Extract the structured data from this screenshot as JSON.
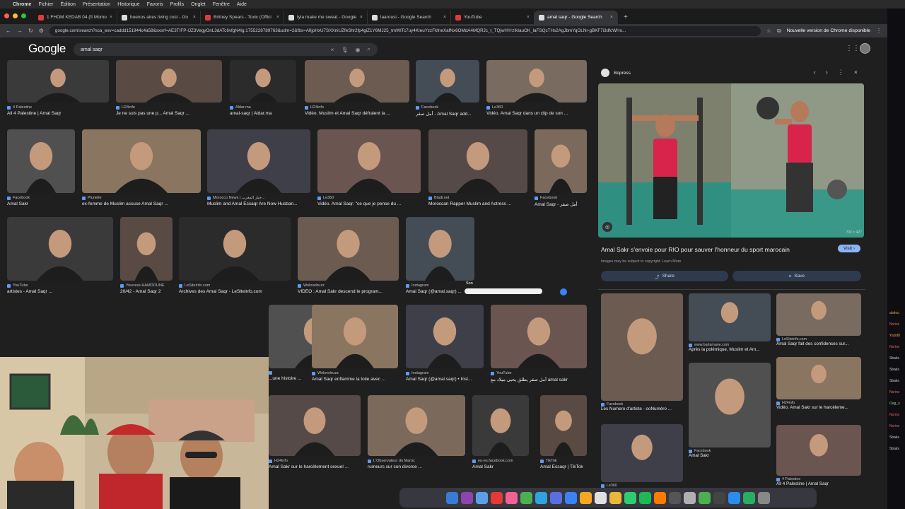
{
  "menubar": {
    "app": "Chrome",
    "items": [
      "Fichier",
      "Édition",
      "Présentation",
      "Historique",
      "Favoris",
      "Profils",
      "Onglet",
      "Fenêtre",
      "Aide"
    ]
  },
  "tabs": [
    {
      "title": "1 FHOM KEDAB 04 (ft Momo",
      "fav": "#e03c3c",
      "active": false
    },
    {
      "title": "buenos aires living cost - Go",
      "fav": "#dddddd",
      "active": false
    },
    {
      "title": "Britney Spears - Toxic (Offici",
      "fav": "#e03c3c",
      "active": false
    },
    {
      "title": "tyla make me sweat - Google",
      "fav": "#dddddd",
      "active": false
    },
    {
      "title": "laarousi - Google Search",
      "fav": "#dddddd",
      "active": false
    },
    {
      "title": "YouTube",
      "fav": "#e03c3c",
      "active": false
    },
    {
      "title": "amal saqr - Google Search",
      "fav": "#dddddd",
      "active": true
    }
  ],
  "toolbar": {
    "url": "google.com/search?sca_esv=caddd151944c4a58&sxsrf=AE3TIFP-lJZ3VegyOnL3dATc6vfgN4Ig:1755228789763&udm=2&fbs=AIIjpHxU7SXXniUZfeShr2fp4giZ1Y6MJ25_tmWITc7uy4KIeuYzzFkfneXafNx6OMdA4MQRJc_t_TQjwHYrzIkIauOK_laFSQcTHs2AgJbmYqOLNr-gBKF7i3dfcWHo...",
    "update_label": "Nouvelle version de Chrome disponible"
  },
  "google": {
    "logo": "Google",
    "query": "amal saqr"
  },
  "results": [
    {
      "src": "4 Palestine",
      "title": "All 4 Palestine | Amal Saqr"
    },
    {
      "src": "H24info",
      "title": "Je ne suis pas une p... Amal Saqr ..."
    },
    {
      "src": "Aldar.ma",
      "title": "amal-saqr | Aldar.ma"
    },
    {
      "src": "H24info",
      "title": "Vidéo. Muslim et Amal Saqr défraient la ..."
    },
    {
      "src": "Facebook",
      "title": "أمل صقر - Amal Saqr add..."
    },
    {
      "src": "Le360",
      "title": "Vidéo. Amal Saqr dans un clip de son ..."
    },
    {
      "src": "Facebook",
      "title": "Amal Sakr"
    },
    {
      "src": "Plurielle",
      "title": "ex-femme de Muslim accuse Amal Saqr ..."
    },
    {
      "src": "Morocco News | خبار المغرب...",
      "title": "Muslim and Amal Essaqr Are Now Husban..."
    },
    {
      "src": "Le360",
      "title": "Vidéo. Amal Saqr: \"ce que je pense du ..."
    },
    {
      "src": "Bladi.net",
      "title": "Moroccan Rapper Muslim and Actress ..."
    },
    {
      "src": "Facebook",
      "title": "Amal Saqr - أمل صقر"
    },
    {
      "src": "YouTube",
      "title": "artistes - Amal Saqr ..."
    },
    {
      "src": "Youness HAMDOUNE",
      "title": "20/42 - Amal Saqr 2"
    },
    {
      "src": "LeSiteinfo.com",
      "title": "Archives des Amal Saqr - LeSiteinfo.com"
    },
    {
      "src": "Welovebuzz",
      "title": "VIDÉO : Amal Sakr descend le program..."
    },
    {
      "src": "Instagram",
      "title": "Amal Saqr (@amal.saqr) ..."
    },
    {
      "src": "",
      "title": "...une histoire ..."
    },
    {
      "src": "Welovebuzz",
      "title": "Amal Saqr enflamme la toile avec ..."
    },
    {
      "src": "Instagram",
      "title": "Amal Saqr (@amal.saqr) • Inst..."
    },
    {
      "src": "YouTube",
      "title": "أمل صقر يطلق يحيى ميلاد مع amal sakr"
    },
    {
      "src": "H24info",
      "title": "Amal Sakr sur le harcèlement sexuel ..."
    },
    {
      "src": "L'Observateur du Maroc",
      "title": "rumeurs sur son divorce ..."
    },
    {
      "src": "eu-es.facebook.com",
      "title": "Amal Sakr"
    },
    {
      "src": "TikTok",
      "title": "Amal Essaqr | TikTok"
    }
  ],
  "panel": {
    "source": "Bopress",
    "title": "Amal Sakr s'envoie pour RIO pour sauver l'honneur du sport marocain",
    "visit_label": "Visit ›",
    "note": "Images may be subject to copyright. Learn More",
    "size": "700 × 427",
    "share_label": "Share",
    "save_label": "Save",
    "related": [
      {
        "src": "Facebook",
        "title": "Les Numero d'artiste - ᴏᴏNuméro ..."
      },
      {
        "src": "www.barlamane.com",
        "title": "Après la polémique, Muslim et Am..."
      },
      {
        "src": "LeSiteinfo.com",
        "title": "Amal Saqr fait des confidences sur..."
      },
      {
        "src": "Facebook",
        "title": "Amal Sakr"
      },
      {
        "src": "H24info",
        "title": "Vidéo. Amal Sakr sur le harcèleme..."
      },
      {
        "src": "Le360",
        "title": ""
      },
      {
        "src": "4 Palestine",
        "title": "All 4 Palestine | Amal Saqr"
      }
    ]
  },
  "video_overlay": {
    "label": "Son"
  },
  "sidebar_chat": [
    "abdou",
    "Nsrins",
    "Yazid8",
    "Nsrins",
    "Sbaks",
    "Sbaks",
    "Sbaks",
    "Nsrins",
    "Oag_s",
    "Nsrins",
    "Nsrins",
    "Sbaks",
    "Sbaks"
  ]
}
